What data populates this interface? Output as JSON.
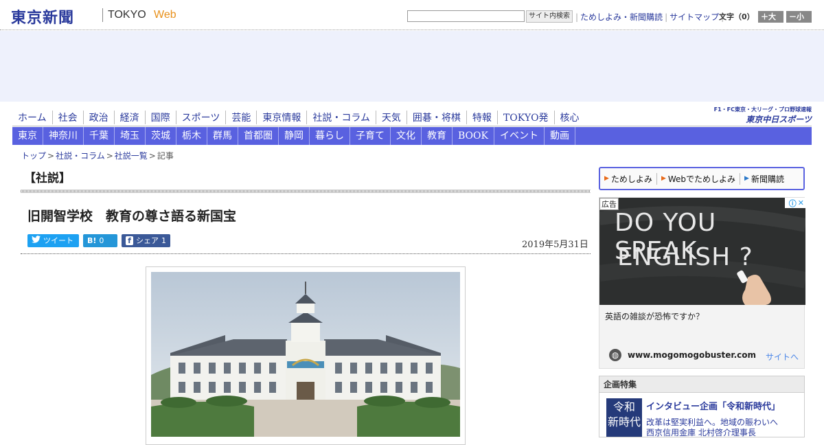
{
  "header": {
    "logo_main": "東京新聞",
    "logo_tokyo": "TOKYO",
    "logo_web": "Web",
    "search_value": "",
    "search_button": "サイト内検索",
    "links": [
      "ためしよみ・新聞購読",
      "サイトマップ"
    ],
    "font_size_label": "文字（0）",
    "font_larger": "＋大",
    "font_smaller": "－小"
  },
  "nav_primary": [
    "ホーム",
    "社会",
    "政治",
    "経済",
    "国際",
    "スポーツ",
    "芸能",
    "東京情報",
    "社説・コラム",
    "天気",
    "囲碁・将棋",
    "特報",
    "TOKYO発",
    "核心"
  ],
  "sports_logo": {
    "sub": "F1・FC東京・大リーグ・プロ野球速報",
    "main": "東京中日スポーツ"
  },
  "nav_secondary": [
    "東京",
    "神奈川",
    "千葉",
    "埼玉",
    "茨城",
    "栃木",
    "群馬",
    "首都圏",
    "静岡",
    "暮らし",
    "子育て",
    "文化",
    "教育",
    "BOOK",
    "イベント",
    "動画"
  ],
  "breadcrumb": [
    "トップ",
    "社説・コラム",
    "社説一覧",
    "記事"
  ],
  "article": {
    "section": "【社説】",
    "headline": "旧開智学校　教育の尊さ語る新国宝",
    "date": "2019年5月31日",
    "share": {
      "tweet_label": "ツイート",
      "hatena_icon": "B!",
      "hatena_count": "0",
      "facebook_icon": "f",
      "facebook_label": "シェア",
      "facebook_count": "1"
    }
  },
  "sidebar": {
    "subscribe": [
      "ためしよみ",
      "Webでためしよみ",
      "新聞購読"
    ],
    "ad": {
      "tag": "広告",
      "image_line1": "DO YOU SPEAK",
      "image_line2": "ENGLISH ?",
      "caption": "英語の雑談が恐怖ですか？",
      "url": "www.mogomogobuster.com",
      "cta": "サイトへ"
    },
    "feature": {
      "heading": "企画特集",
      "thumb_line1": "令和",
      "thumb_line2": "新時代",
      "title": "インタビュー企画「令和新時代」",
      "desc_line1": "改革は堅実利益へ。地域の賑わいへ",
      "desc_line2": "西京信用金庫 北村啓介理事長"
    }
  },
  "colors": {
    "brand_blue": "#2a3a9c",
    "nav_bar": "#5961e0",
    "web_orange": "#e8901a",
    "ad_band": "#eef1fc"
  }
}
